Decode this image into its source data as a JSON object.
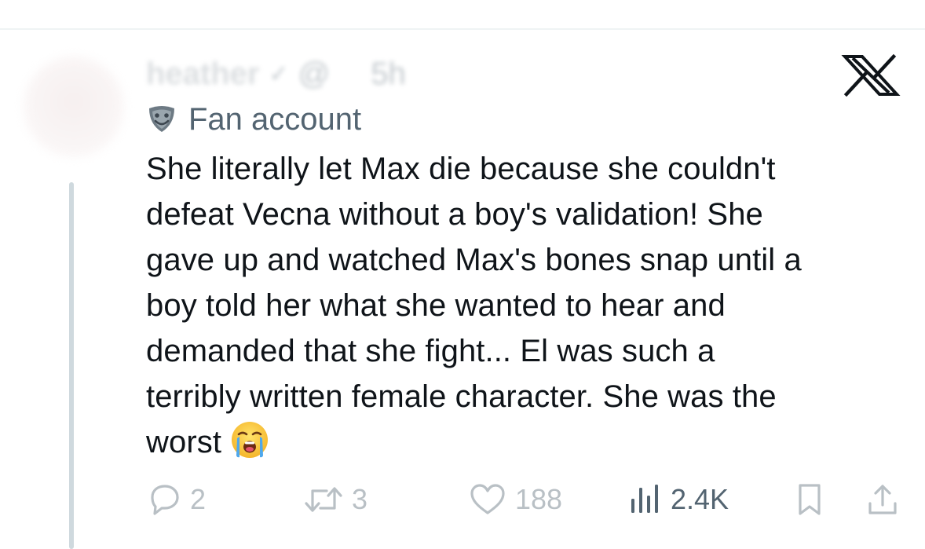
{
  "tweet": {
    "author_name": "heather",
    "author_handle": "@",
    "timestamp": "5h",
    "label": "Fan account",
    "text_lines": [
      "She literally let Max die because she couldn't",
      "defeat Vecna without a boy's validation! She",
      "gave up and watched Max's bones snap until a",
      "boy told her what she wanted to hear and",
      "demanded that she fight... El was such a",
      "terribly written female character. She was the",
      "worst"
    ],
    "emoji": "loudly-crying-face"
  },
  "actions": {
    "reply_count": "2",
    "retweet_count": "3",
    "like_count": "188",
    "views_count": "2.4K"
  },
  "icons": {
    "platform_logo": "x-logo-icon",
    "label_icon": "theater-mask-icon",
    "reply": "reply-icon",
    "retweet": "retweet-icon",
    "like": "heart-icon",
    "views": "views-icon",
    "bookmark": "bookmark-icon",
    "share": "share-icon"
  },
  "colors": {
    "text_primary": "#0f1419",
    "text_secondary": "#536471",
    "thread_line": "#cfd9de"
  }
}
